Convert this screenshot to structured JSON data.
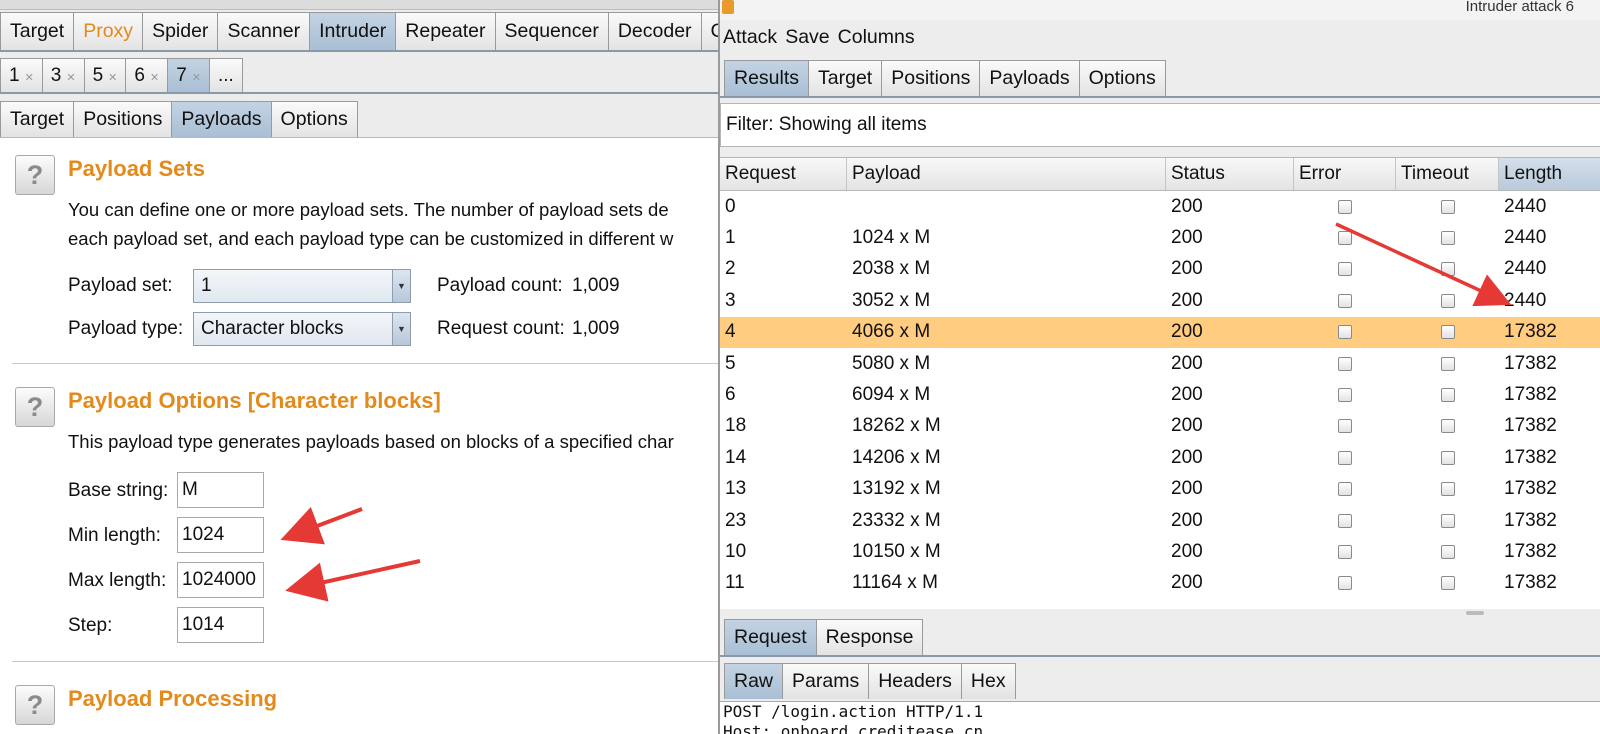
{
  "left": {
    "main_tabs": [
      "Target",
      "Proxy",
      "Spider",
      "Scanner",
      "Intruder",
      "Repeater",
      "Sequencer",
      "Decoder",
      "C"
    ],
    "main_active": "Intruder",
    "number_tabs": [
      "1",
      "3",
      "5",
      "6",
      "7"
    ],
    "number_more": "...",
    "sub_tabs": [
      "Target",
      "Positions",
      "Payloads",
      "Options"
    ],
    "sub_active": "Payloads",
    "payload_sets": {
      "title": "Payload Sets",
      "desc_line1": "You can define one or more payload sets. The number of payload sets de",
      "desc_line2": "each payload set, and each payload type can be customized in different w",
      "set_label": "Payload set:",
      "set_value": "1",
      "count_label": "Payload count:",
      "count_value": "1,009",
      "type_label": "Payload type:",
      "type_value": "Character blocks",
      "request_label": "Request count:",
      "request_value": "1,009"
    },
    "payload_options": {
      "title": "Payload Options [Character blocks]",
      "desc": "This payload type generates payloads based on blocks of a specified char",
      "base_label": "Base string:",
      "base_value": "M",
      "min_label": "Min length:",
      "min_value": "1024",
      "max_label": "Max length:",
      "max_value": "1024000",
      "step_label": "Step:",
      "step_value": "1014"
    },
    "payload_processing": {
      "title": "Payload Processing"
    },
    "help_glyph": "?"
  },
  "right": {
    "window_title": "Intruder attack 6",
    "menu": [
      "Attack",
      "Save",
      "Columns"
    ],
    "tabs": [
      "Results",
      "Target",
      "Positions",
      "Payloads",
      "Options"
    ],
    "tabs_active": "Results",
    "filter": "Filter: Showing all items",
    "columns": [
      "Request",
      "Payload",
      "Status",
      "Error",
      "Timeout",
      "Length"
    ],
    "sorted_column": "Length",
    "rows": [
      {
        "request": "0",
        "payload": "",
        "status": "200",
        "length": "2440"
      },
      {
        "request": "1",
        "payload": "1024 x M",
        "status": "200",
        "length": "2440"
      },
      {
        "request": "2",
        "payload": "2038 x M",
        "status": "200",
        "length": "2440"
      },
      {
        "request": "3",
        "payload": "3052 x M",
        "status": "200",
        "length": "2440"
      },
      {
        "request": "4",
        "payload": "4066 x M",
        "status": "200",
        "length": "17382",
        "selected": true
      },
      {
        "request": "5",
        "payload": "5080 x M",
        "status": "200",
        "length": "17382"
      },
      {
        "request": "6",
        "payload": "6094 x M",
        "status": "200",
        "length": "17382"
      },
      {
        "request": "18",
        "payload": "18262 x M",
        "status": "200",
        "length": "17382"
      },
      {
        "request": "14",
        "payload": "14206 x M",
        "status": "200",
        "length": "17382"
      },
      {
        "request": "13",
        "payload": "13192 x M",
        "status": "200",
        "length": "17382"
      },
      {
        "request": "23",
        "payload": "23332 x M",
        "status": "200",
        "length": "17382"
      },
      {
        "request": "10",
        "payload": "10150 x M",
        "status": "200",
        "length": "17382"
      },
      {
        "request": "11",
        "payload": "11164 x M",
        "status": "200",
        "length": "17382"
      }
    ],
    "req_tabs": [
      "Request",
      "Response"
    ],
    "req_active": "Request",
    "raw_tabs": [
      "Raw",
      "Params",
      "Headers",
      "Hex"
    ],
    "raw_active": "Raw",
    "editor_line1": "POST /login.action HTTP/1.1",
    "editor_line2": "Host: onboard.creditease.cn"
  },
  "colors": {
    "accent_orange": "#e38a1c",
    "selected_row": "#ffcc80",
    "active_tab": "#b5c8da",
    "annotation_arrow": "#e53935"
  }
}
